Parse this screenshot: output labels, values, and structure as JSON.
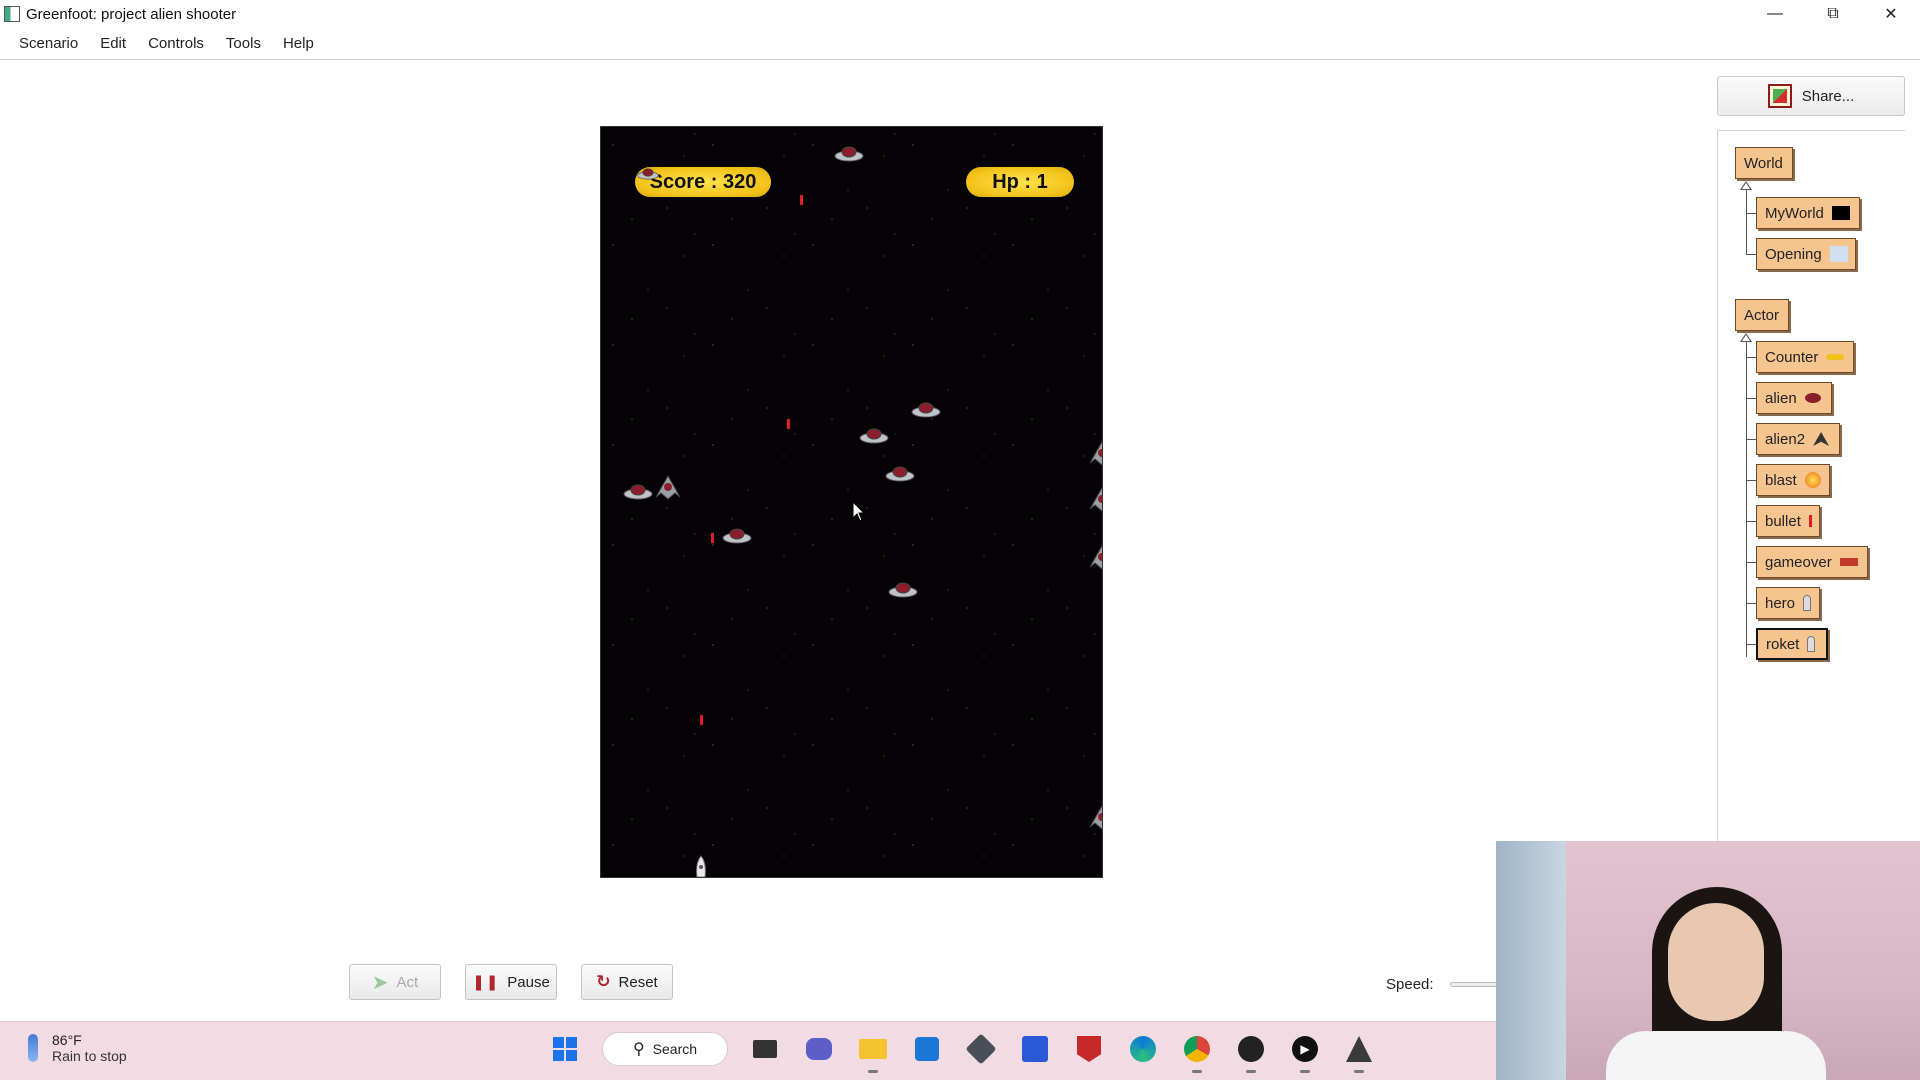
{
  "window": {
    "title": "Greenfoot: project alien shooter"
  },
  "menu": [
    "Scenario",
    "Edit",
    "Controls",
    "Tools",
    "Help"
  ],
  "hud": {
    "score": "Score : 320",
    "hp": "Hp : 1"
  },
  "share": {
    "label": "Share..."
  },
  "classes": {
    "world_root": "World",
    "world_children": [
      "MyWorld",
      "Opening"
    ],
    "actor_root": "Actor",
    "actor_children": [
      "Counter",
      "alien",
      "alien2",
      "blast",
      "bullet",
      "gameover",
      "hero",
      "roket"
    ],
    "selected": "roket"
  },
  "controls": {
    "act": "Act",
    "pause": "Pause",
    "reset": "Reset",
    "speed_label": "Speed:"
  },
  "taskbar": {
    "temperature": "86°F",
    "weather": "Rain to stop",
    "search": "Search",
    "apps": [
      "start-icon",
      "search",
      "file-explorer-icon",
      "teams-icon",
      "folder-icon",
      "store-icon",
      "app-cube-icon",
      "app-blue-icon",
      "mcafee-icon",
      "edge-icon",
      "chrome-icon",
      "app-red-dot-icon",
      "media-player-icon",
      "greenfoot-icon"
    ]
  },
  "colors": {
    "class_fill": "#f6c48f",
    "hud_pill": "#f2c21a",
    "bullet": "#e11d2b",
    "taskbar": "#f3dbe4"
  }
}
